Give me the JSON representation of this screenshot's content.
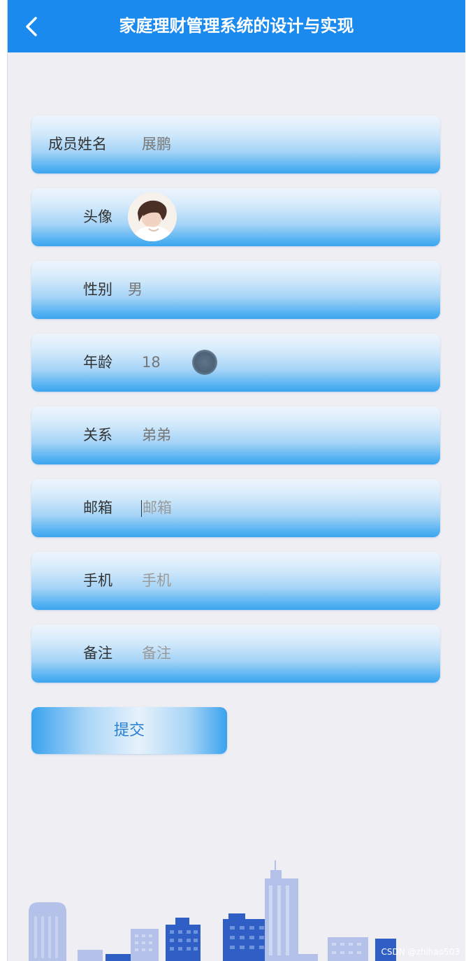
{
  "header": {
    "title": "家庭理财管理系统的设计与实现",
    "back_icon": "chevron-left-icon"
  },
  "form": {
    "fields": [
      {
        "key": "name",
        "label": "成员姓名",
        "value": "展鹏",
        "is_placeholder": false
      },
      {
        "key": "avatar",
        "label": "头像",
        "value": "",
        "icon": "avatar-image"
      },
      {
        "key": "gender",
        "label": "性别",
        "value": "男",
        "is_placeholder": false
      },
      {
        "key": "age",
        "label": "年龄",
        "value": "18",
        "is_placeholder": false
      },
      {
        "key": "relation",
        "label": "关系",
        "value": "弟弟",
        "is_placeholder": false
      },
      {
        "key": "email",
        "label": "邮箱",
        "value": "邮箱",
        "is_placeholder": true,
        "focused": true
      },
      {
        "key": "phone",
        "label": "手机",
        "value": "手机",
        "is_placeholder": true
      },
      {
        "key": "note",
        "label": "备注",
        "value": "备注",
        "is_placeholder": true
      }
    ],
    "submit_label": "提交"
  },
  "watermark": "CSDN @zhihao503",
  "colors": {
    "header_bg": "#1a8aee",
    "page_bg": "#efeef3",
    "row_gradient_bottom": "#3ba6ef",
    "submit_text": "#2b7fd3",
    "skyline_light": "#aebde6",
    "skyline_dark": "#2f5fc4"
  }
}
